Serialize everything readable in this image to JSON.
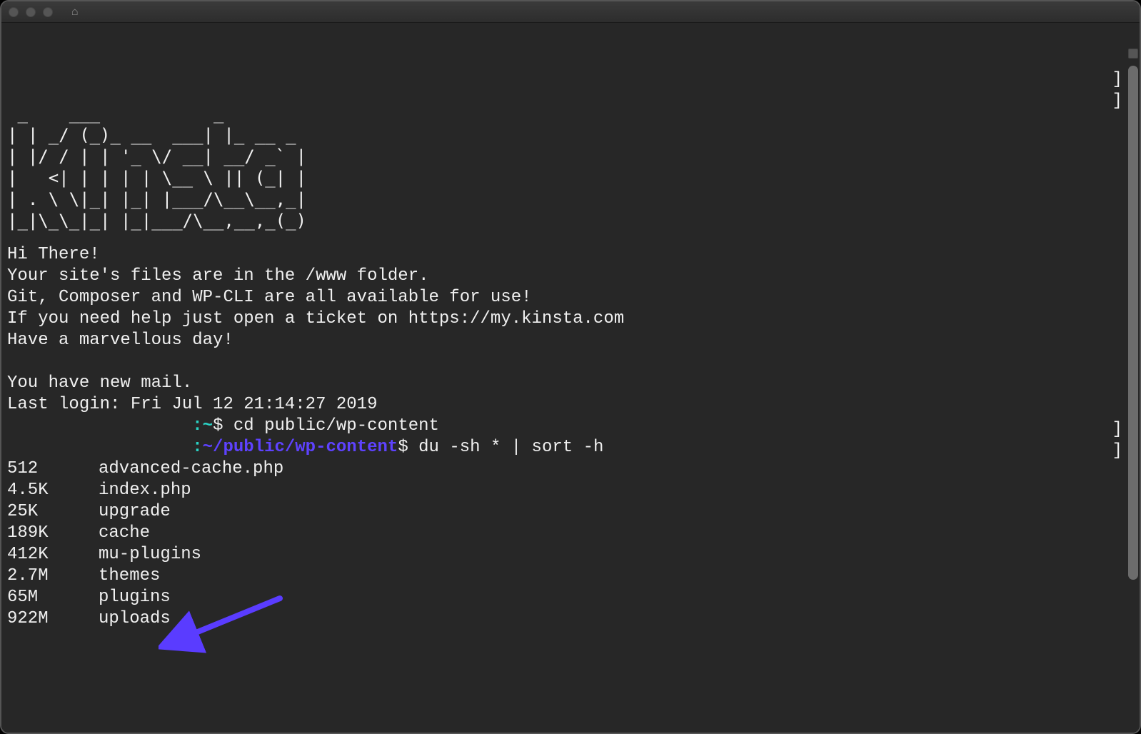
{
  "titlebar": {
    "home_icon": "⌂"
  },
  "ascii_art": " _    ___           _\n| | _/ (_)_ __  ___| |_ __ _\n| |/ / | | '_ \\/ __| __/ _` |\n|   <| | | | | \\__ \\ || (_| |\n| . \\ \\|_| |_| |___/\\__\\__,_|\n|_|\\_\\_|_| |_|___/\\__,__,_(_)",
  "motd": {
    "greeting": "Hi There!",
    "files_note": "Your site's files are in the /www folder.",
    "tools_note": "Git, Composer and WP-CLI are all available for use!",
    "help_note": "If you need help just open a ticket on https://my.kinsta.com",
    "closing": "Have a marvellous day!"
  },
  "mail_notice": "You have new mail.",
  "last_login": "Last login: Fri Jul 12 21:14:27 2019",
  "prompt1": {
    "pad": "                  ",
    "host_path": ":~",
    "sigil": "$ ",
    "command": "cd public/wp-content"
  },
  "prompt2": {
    "pad": "                  ",
    "colon": ":",
    "path": "~/public/wp-content",
    "sigil": "$ ",
    "command": "du -sh * | sort -h"
  },
  "listing": [
    {
      "size": "512",
      "name": "advanced-cache.php"
    },
    {
      "size": "4.5K",
      "name": "index.php"
    },
    {
      "size": "25K",
      "name": "upgrade"
    },
    {
      "size": "189K",
      "name": "cache"
    },
    {
      "size": "412K",
      "name": "mu-plugins"
    },
    {
      "size": "2.7M",
      "name": "themes"
    },
    {
      "size": "65M",
      "name": "plugins"
    },
    {
      "size": "922M",
      "name": "uploads"
    }
  ],
  "brackets": {
    "br1": "]",
    "br2": "]",
    "br3": "]",
    "br4": "]"
  }
}
